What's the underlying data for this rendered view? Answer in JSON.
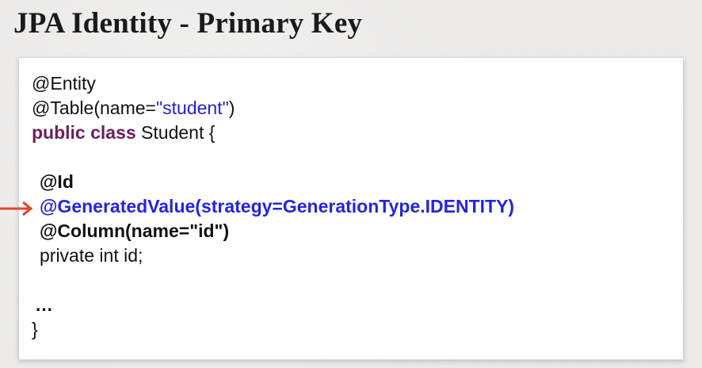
{
  "slide": {
    "title": "JPA Identity - Primary Key"
  },
  "code": {
    "line1": "@Entity",
    "line2_prefix": "@Table(name=",
    "line2_string": "\"student\"",
    "line2_suffix": ")",
    "line3_keyword": "public class",
    "line3_rest": " Student {",
    "line5": "@Id",
    "line6": "@GeneratedValue(strategy=GenerationType.IDENTITY)",
    "line7": "@Column(name=\"id\")",
    "line8": "private int id;",
    "line10": "…",
    "line11": "}"
  },
  "colors": {
    "keyword": "#6b1f5c",
    "string": "#2222d6",
    "highlight": "#2424e0",
    "arrow": "#e0452b"
  }
}
